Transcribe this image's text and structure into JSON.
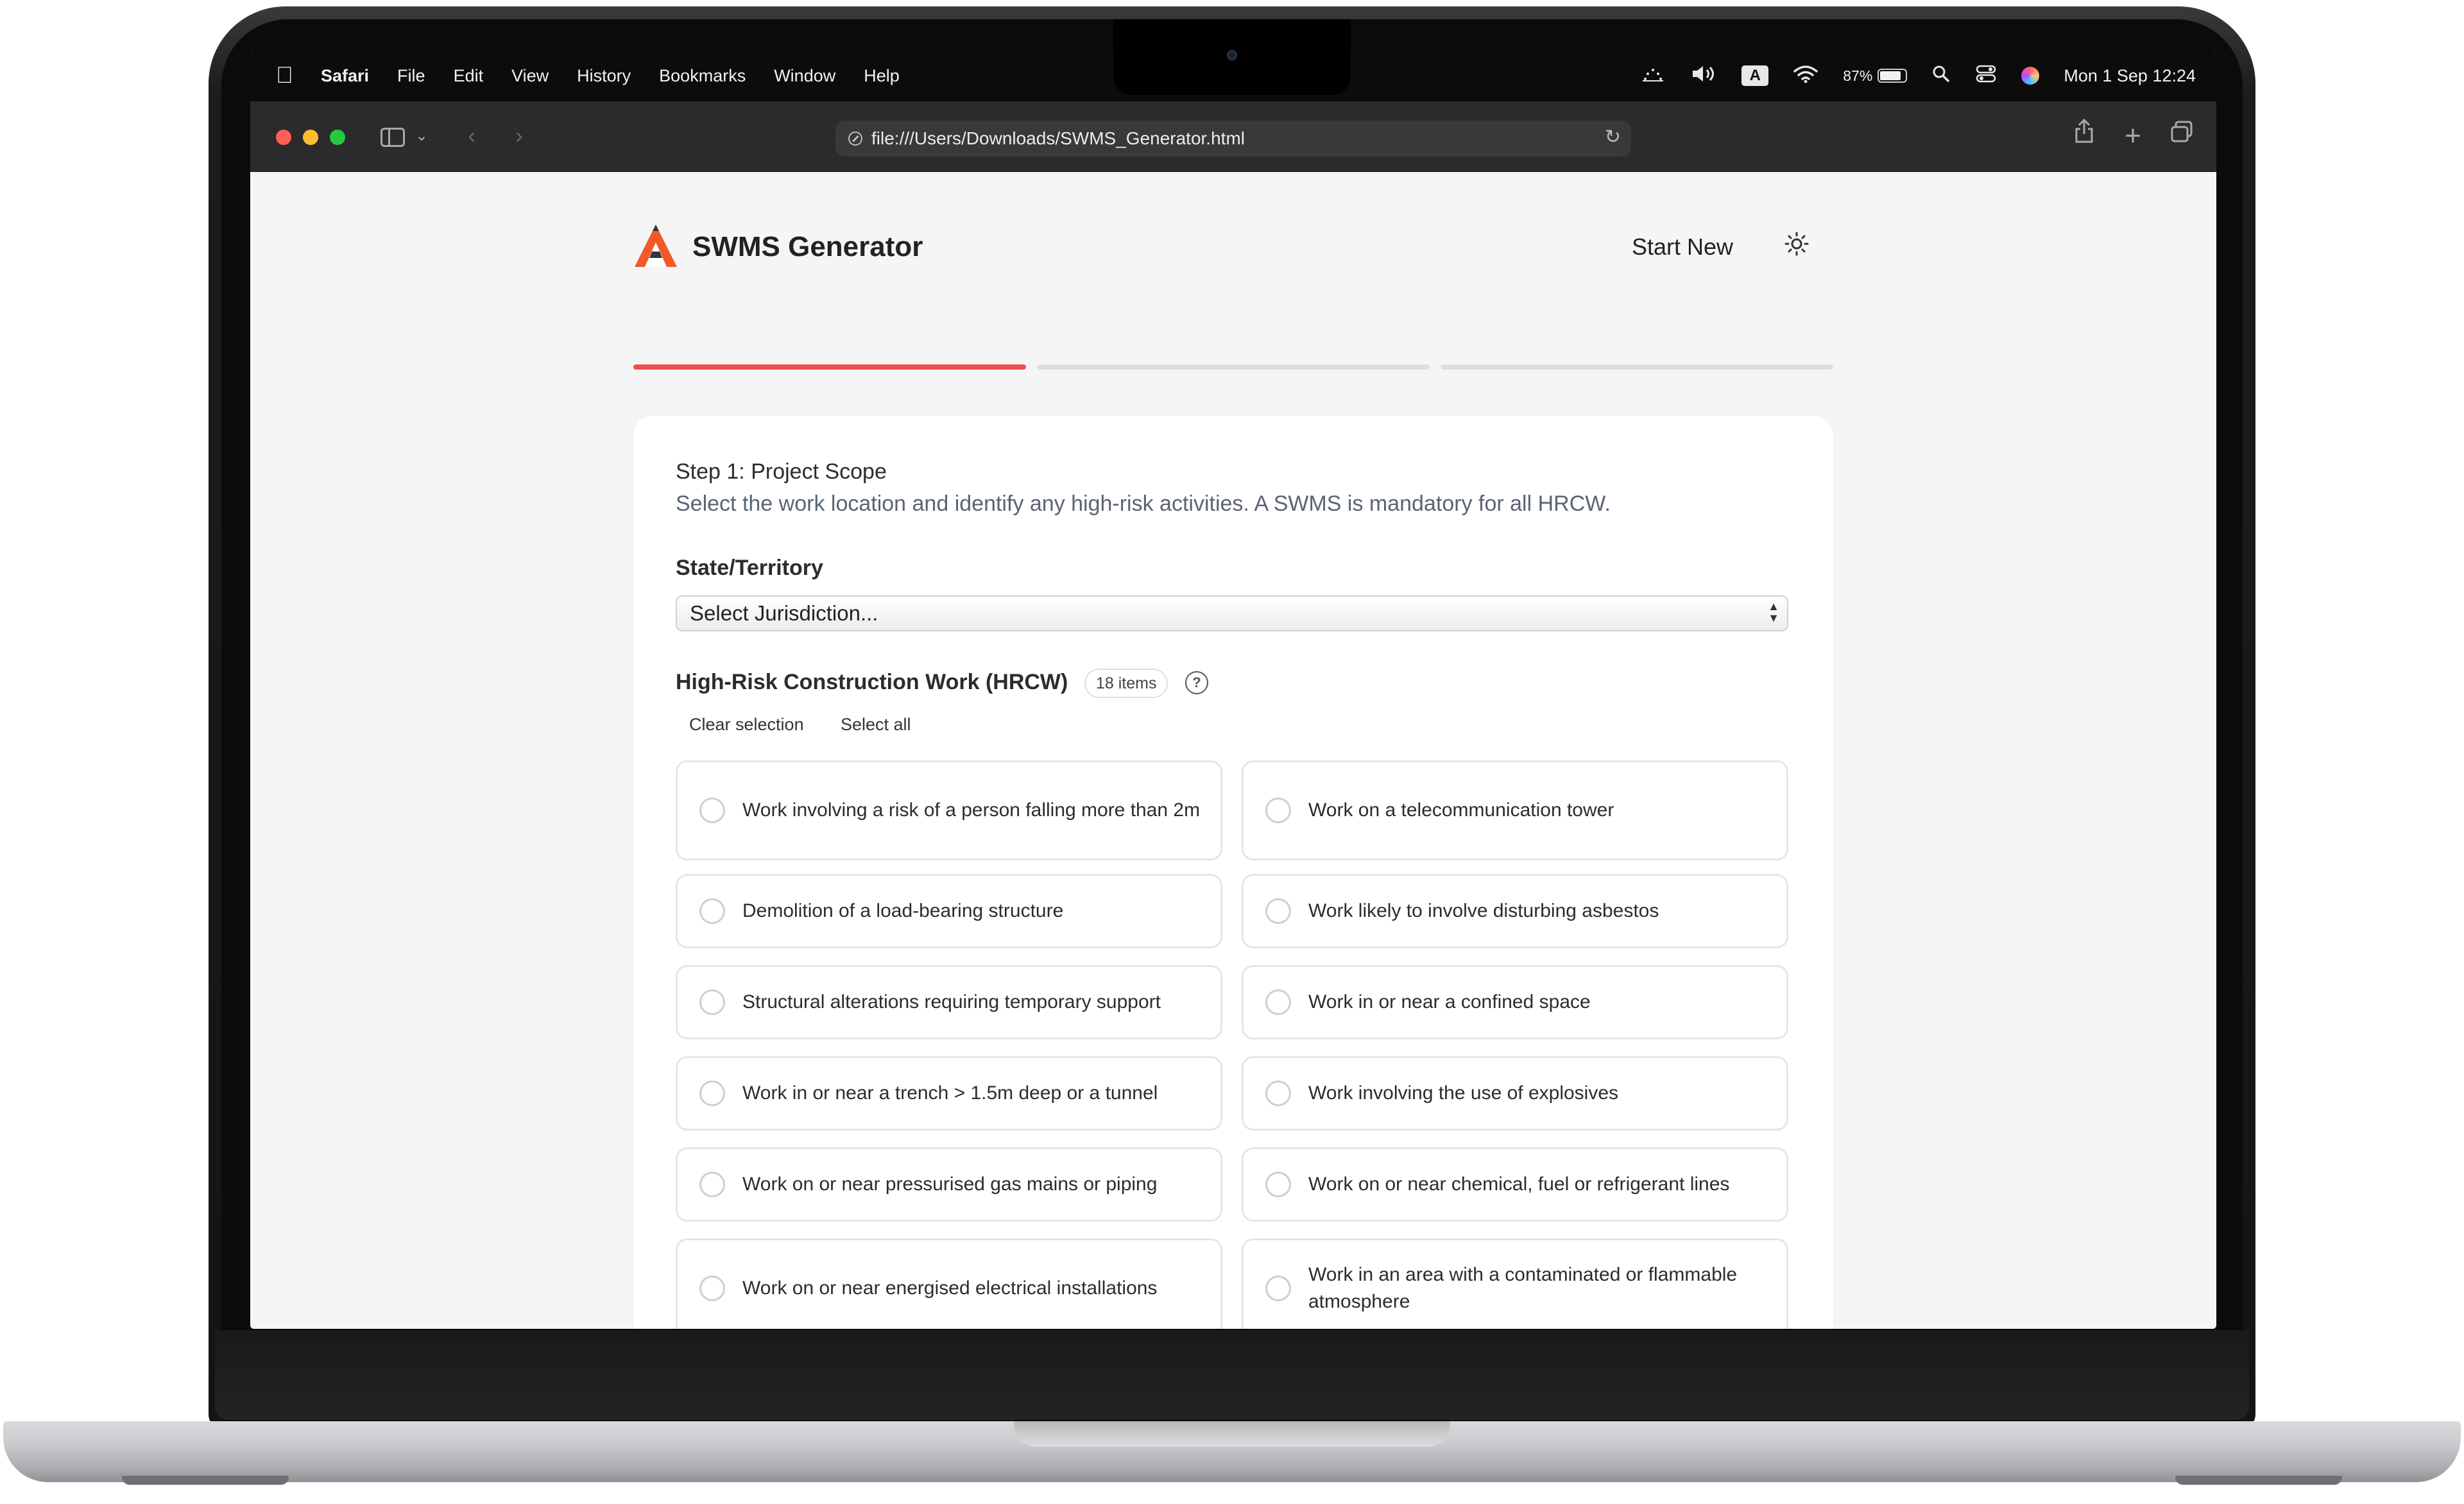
{
  "menubar": {
    "app_name": "Safari",
    "menus": [
      "File",
      "Edit",
      "View",
      "History",
      "Bookmarks",
      "Window",
      "Help"
    ],
    "battery_percent": "87%",
    "input_source": "A",
    "datetime": "Mon 1 Sep  12:24"
  },
  "browser": {
    "url": "file:///Users/Downloads/SWMS_Generator.html"
  },
  "app": {
    "title": "SWMS Generator",
    "start_new_label": "Start New",
    "progress": {
      "current_step": 1,
      "total_steps": 3
    },
    "colors": {
      "accent": "#ef4d4f",
      "logo_orange": "#f05a28",
      "logo_dark": "#2f3640"
    }
  },
  "step": {
    "title": "Step 1: Project Scope",
    "description": "Select the work location and identify any high-risk activities. A SWMS is mandatory for all HRCW."
  },
  "jurisdiction": {
    "label": "State/Territory",
    "selected": "Select Jurisdiction..."
  },
  "hrcw": {
    "title": "High-Risk Construction Work (HRCW)",
    "count_badge": "18 items",
    "clear_label": "Clear selection",
    "select_all_label": "Select all",
    "options": [
      "Work involving a risk of a person falling more than 2m",
      "Work on a telecommunication tower",
      "Demolition of a load-bearing structure",
      "Work likely to involve disturbing asbestos",
      "Structural alterations requiring temporary support",
      "Work in or near a confined space",
      "Work in or near a trench > 1.5m deep or a tunnel",
      "Work involving the use of explosives",
      "Work on or near pressurised gas mains or piping",
      "Work on or near chemical, fuel or refrigerant lines",
      "Work on or near energised electrical installations",
      "Work in an area with a contaminated or flammable atmosphere"
    ]
  }
}
